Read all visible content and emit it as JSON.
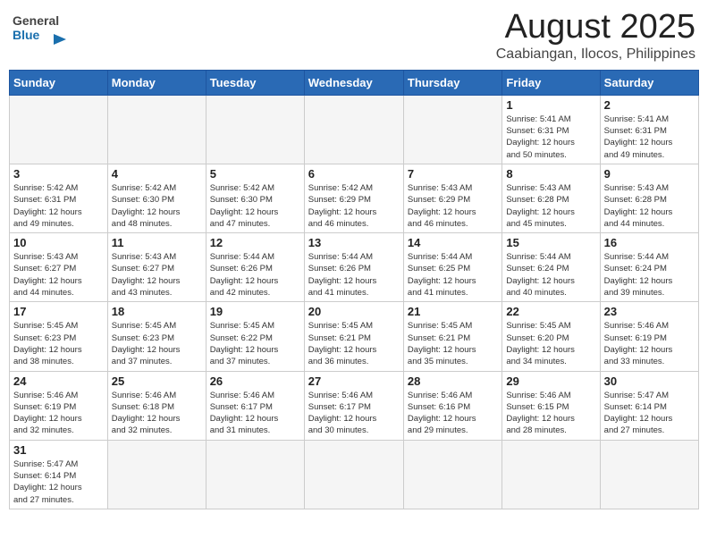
{
  "header": {
    "logo_general": "General",
    "logo_blue": "Blue",
    "title": "August 2025",
    "subtitle": "Caabiangan, Ilocos, Philippines"
  },
  "days_of_week": [
    "Sunday",
    "Monday",
    "Tuesday",
    "Wednesday",
    "Thursday",
    "Friday",
    "Saturday"
  ],
  "weeks": [
    {
      "days": [
        {
          "number": "",
          "info": ""
        },
        {
          "number": "",
          "info": ""
        },
        {
          "number": "",
          "info": ""
        },
        {
          "number": "",
          "info": ""
        },
        {
          "number": "",
          "info": ""
        },
        {
          "number": "1",
          "info": "Sunrise: 5:41 AM\nSunset: 6:31 PM\nDaylight: 12 hours\nand 50 minutes."
        },
        {
          "number": "2",
          "info": "Sunrise: 5:41 AM\nSunset: 6:31 PM\nDaylight: 12 hours\nand 49 minutes."
        }
      ]
    },
    {
      "days": [
        {
          "number": "3",
          "info": "Sunrise: 5:42 AM\nSunset: 6:31 PM\nDaylight: 12 hours\nand 49 minutes."
        },
        {
          "number": "4",
          "info": "Sunrise: 5:42 AM\nSunset: 6:30 PM\nDaylight: 12 hours\nand 48 minutes."
        },
        {
          "number": "5",
          "info": "Sunrise: 5:42 AM\nSunset: 6:30 PM\nDaylight: 12 hours\nand 47 minutes."
        },
        {
          "number": "6",
          "info": "Sunrise: 5:42 AM\nSunset: 6:29 PM\nDaylight: 12 hours\nand 46 minutes."
        },
        {
          "number": "7",
          "info": "Sunrise: 5:43 AM\nSunset: 6:29 PM\nDaylight: 12 hours\nand 46 minutes."
        },
        {
          "number": "8",
          "info": "Sunrise: 5:43 AM\nSunset: 6:28 PM\nDaylight: 12 hours\nand 45 minutes."
        },
        {
          "number": "9",
          "info": "Sunrise: 5:43 AM\nSunset: 6:28 PM\nDaylight: 12 hours\nand 44 minutes."
        }
      ]
    },
    {
      "days": [
        {
          "number": "10",
          "info": "Sunrise: 5:43 AM\nSunset: 6:27 PM\nDaylight: 12 hours\nand 44 minutes."
        },
        {
          "number": "11",
          "info": "Sunrise: 5:43 AM\nSunset: 6:27 PM\nDaylight: 12 hours\nand 43 minutes."
        },
        {
          "number": "12",
          "info": "Sunrise: 5:44 AM\nSunset: 6:26 PM\nDaylight: 12 hours\nand 42 minutes."
        },
        {
          "number": "13",
          "info": "Sunrise: 5:44 AM\nSunset: 6:26 PM\nDaylight: 12 hours\nand 41 minutes."
        },
        {
          "number": "14",
          "info": "Sunrise: 5:44 AM\nSunset: 6:25 PM\nDaylight: 12 hours\nand 41 minutes."
        },
        {
          "number": "15",
          "info": "Sunrise: 5:44 AM\nSunset: 6:24 PM\nDaylight: 12 hours\nand 40 minutes."
        },
        {
          "number": "16",
          "info": "Sunrise: 5:44 AM\nSunset: 6:24 PM\nDaylight: 12 hours\nand 39 minutes."
        }
      ]
    },
    {
      "days": [
        {
          "number": "17",
          "info": "Sunrise: 5:45 AM\nSunset: 6:23 PM\nDaylight: 12 hours\nand 38 minutes."
        },
        {
          "number": "18",
          "info": "Sunrise: 5:45 AM\nSunset: 6:23 PM\nDaylight: 12 hours\nand 37 minutes."
        },
        {
          "number": "19",
          "info": "Sunrise: 5:45 AM\nSunset: 6:22 PM\nDaylight: 12 hours\nand 37 minutes."
        },
        {
          "number": "20",
          "info": "Sunrise: 5:45 AM\nSunset: 6:21 PM\nDaylight: 12 hours\nand 36 minutes."
        },
        {
          "number": "21",
          "info": "Sunrise: 5:45 AM\nSunset: 6:21 PM\nDaylight: 12 hours\nand 35 minutes."
        },
        {
          "number": "22",
          "info": "Sunrise: 5:45 AM\nSunset: 6:20 PM\nDaylight: 12 hours\nand 34 minutes."
        },
        {
          "number": "23",
          "info": "Sunrise: 5:46 AM\nSunset: 6:19 PM\nDaylight: 12 hours\nand 33 minutes."
        }
      ]
    },
    {
      "days": [
        {
          "number": "24",
          "info": "Sunrise: 5:46 AM\nSunset: 6:19 PM\nDaylight: 12 hours\nand 32 minutes."
        },
        {
          "number": "25",
          "info": "Sunrise: 5:46 AM\nSunset: 6:18 PM\nDaylight: 12 hours\nand 32 minutes."
        },
        {
          "number": "26",
          "info": "Sunrise: 5:46 AM\nSunset: 6:17 PM\nDaylight: 12 hours\nand 31 minutes."
        },
        {
          "number": "27",
          "info": "Sunrise: 5:46 AM\nSunset: 6:17 PM\nDaylight: 12 hours\nand 30 minutes."
        },
        {
          "number": "28",
          "info": "Sunrise: 5:46 AM\nSunset: 6:16 PM\nDaylight: 12 hours\nand 29 minutes."
        },
        {
          "number": "29",
          "info": "Sunrise: 5:46 AM\nSunset: 6:15 PM\nDaylight: 12 hours\nand 28 minutes."
        },
        {
          "number": "30",
          "info": "Sunrise: 5:47 AM\nSunset: 6:14 PM\nDaylight: 12 hours\nand 27 minutes."
        }
      ]
    },
    {
      "days": [
        {
          "number": "31",
          "info": "Sunrise: 5:47 AM\nSunset: 6:14 PM\nDaylight: 12 hours\nand 27 minutes."
        },
        {
          "number": "",
          "info": ""
        },
        {
          "number": "",
          "info": ""
        },
        {
          "number": "",
          "info": ""
        },
        {
          "number": "",
          "info": ""
        },
        {
          "number": "",
          "info": ""
        },
        {
          "number": "",
          "info": ""
        }
      ]
    }
  ]
}
